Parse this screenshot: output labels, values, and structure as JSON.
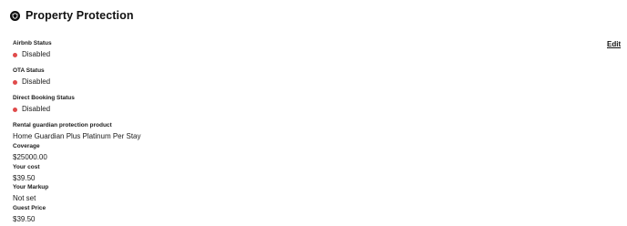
{
  "section": {
    "title": "Property Protection",
    "icon": "shield-icon",
    "edit_label": "Edit"
  },
  "statuses": [
    {
      "label": "Airbnb Status",
      "value": "Disabled",
      "color": "#e04b4b"
    },
    {
      "label": "OTA Status",
      "value": "Disabled",
      "color": "#e04b4b"
    },
    {
      "label": "Direct Booking Status",
      "value": "Disabled",
      "color": "#e04b4b"
    }
  ],
  "details": {
    "product_label": "Rental guardian protection product",
    "product_value": "Home Guardian Plus Platinum Per Stay",
    "coverage_label": "Coverage",
    "coverage_value": "$25000.00",
    "cost_label": "Your cost",
    "cost_value": "$39.50",
    "markup_label": "Your Markup",
    "markup_value": "Not set",
    "guest_price_label": "Guest Price",
    "guest_price_value": "$39.50"
  }
}
